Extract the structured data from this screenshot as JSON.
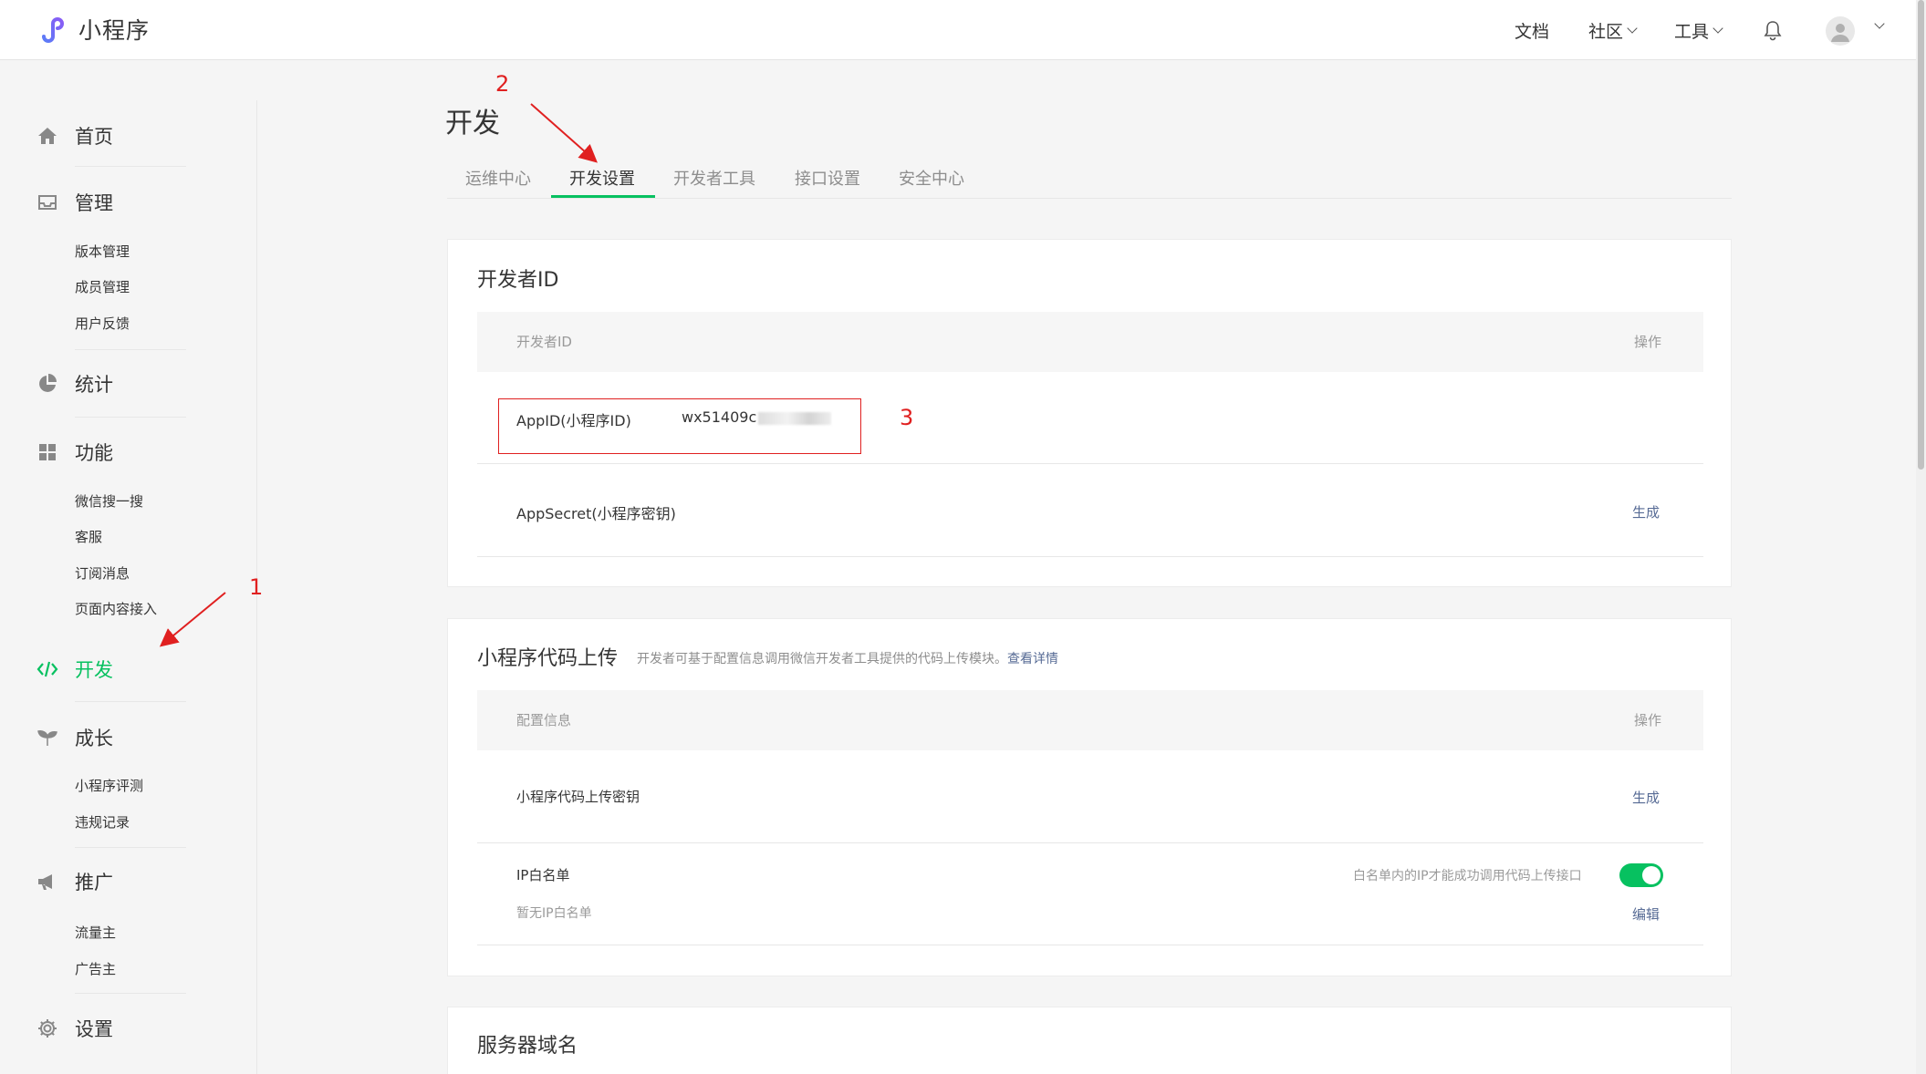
{
  "header": {
    "app_name": "小程序",
    "nav": [
      {
        "label": "文档"
      },
      {
        "label": "社区"
      },
      {
        "label": "工具"
      }
    ]
  },
  "sidebar": {
    "home": "首页",
    "manage": "管理",
    "manage_sub": [
      "版本管理",
      "成员管理",
      "用户反馈"
    ],
    "stats": "统计",
    "features": "功能",
    "features_sub": [
      "微信搜一搜",
      "客服",
      "订阅消息",
      "页面内容接入"
    ],
    "develop": "开发",
    "growth": "成长",
    "growth_sub": [
      "小程序评测",
      "违规记录"
    ],
    "promote": "推广",
    "promote_sub": [
      "流量主",
      "广告主"
    ],
    "settings": "设置"
  },
  "page": {
    "title": "开发",
    "tabs": [
      "运维中心",
      "开发设置",
      "开发者工具",
      "接口设置",
      "安全中心"
    ],
    "active_tab": "开发设置"
  },
  "dev_id_card": {
    "title": "开发者ID",
    "col_name": "开发者ID",
    "col_action": "操作",
    "appid_label": "AppID(小程序ID)",
    "appid_value": "wx51409c",
    "appsecret_label": "AppSecret(小程序密钥)",
    "appsecret_action": "生成"
  },
  "upload_card": {
    "title": "小程序代码上传",
    "desc": "开发者可基于配置信息调用微信开发者工具提供的代码上传模块。",
    "desc_link": "查看详情",
    "col_name": "配置信息",
    "col_action": "操作",
    "key_label": "小程序代码上传密钥",
    "key_action": "生成",
    "ip_label": "IP白名单",
    "ip_empty": "暂无IP白名单",
    "ip_hint": "白名单内的IP才能成功调用代码上传接口",
    "ip_toggle_on": true,
    "ip_action": "编辑"
  },
  "server_card": {
    "title": "服务器域名"
  },
  "annotations": {
    "one": "1",
    "two": "2",
    "three": "3"
  },
  "colors": {
    "accent": "#07c160",
    "link": "#576b95",
    "annotation": "#e02020"
  }
}
